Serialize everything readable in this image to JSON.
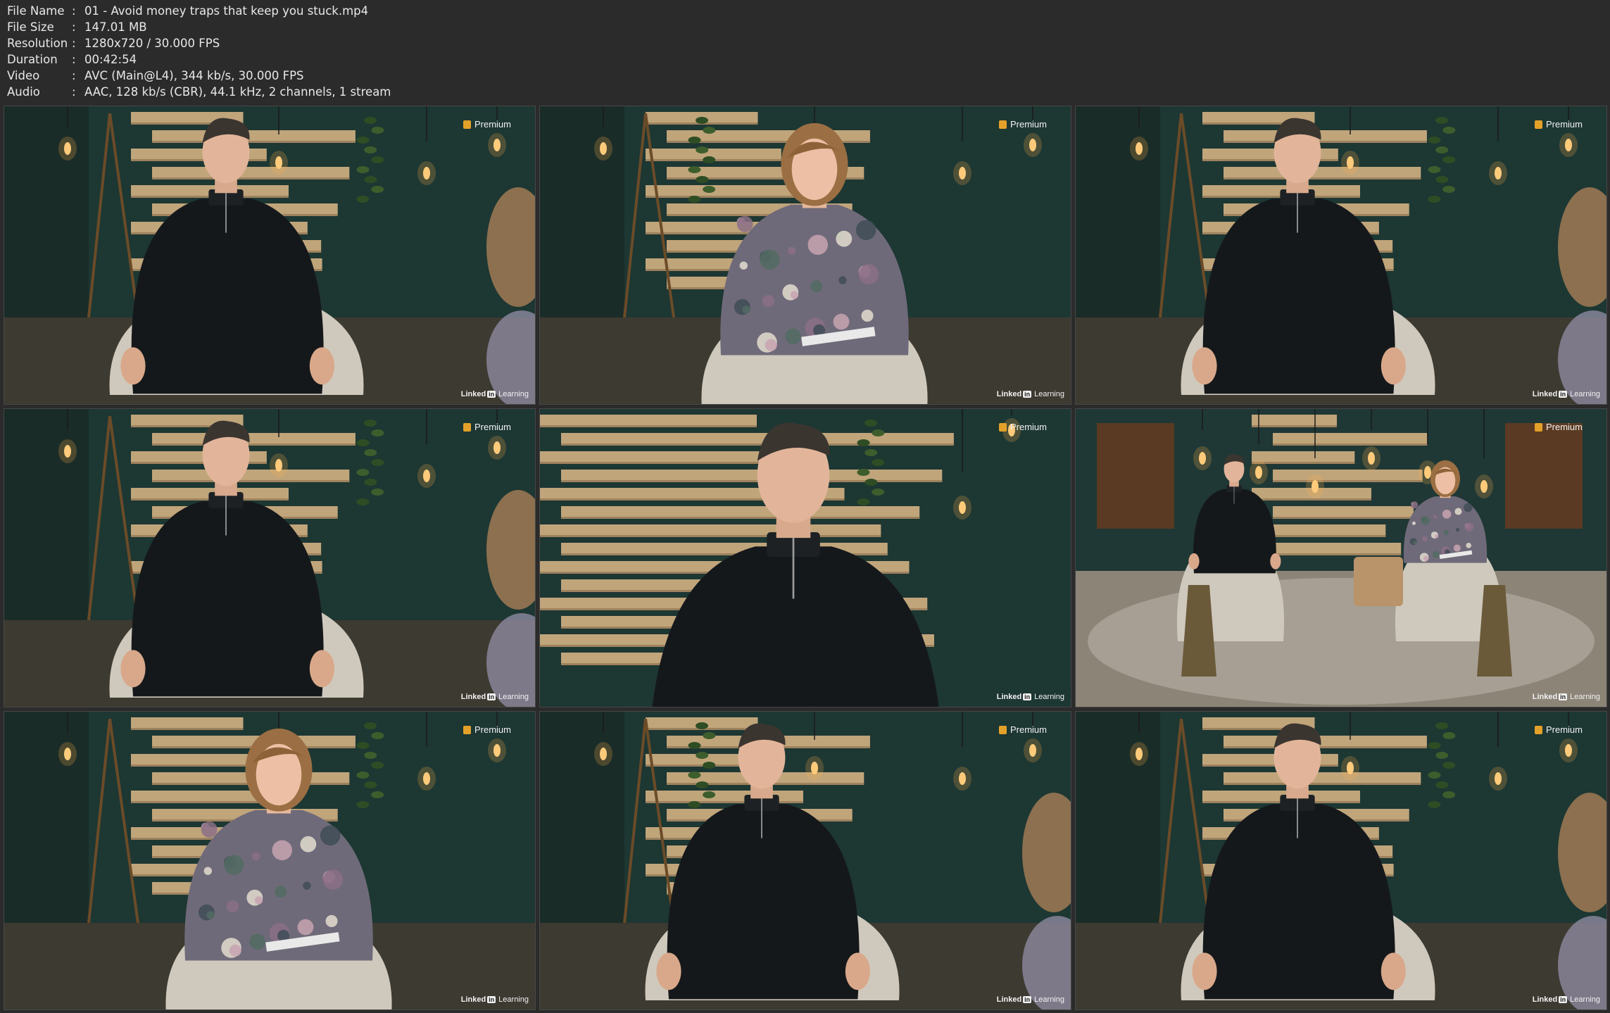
{
  "file_info": [
    {
      "label": "File Name",
      "sep": ":",
      "value": "01 - Avoid money traps that keep you stuck.mp4"
    },
    {
      "label": "File Size",
      "sep": ":",
      "value": "147.01 MB"
    },
    {
      "label": "Resolution",
      "sep": ":",
      "value": "1280x720 / 30.000 FPS"
    },
    {
      "label": "Duration",
      "sep": ":",
      "value": "00:42:54"
    },
    {
      "label": "Video",
      "sep": ":",
      "value": "AVC (Main@L4), 344 kb/s, 30.000 FPS"
    },
    {
      "label": "Audio",
      "sep": ":",
      "value": "AAC, 128 kb/s (CBR), 44.1 kHz, 2 channels, 1 stream"
    }
  ],
  "overlay": {
    "badge_text": "Premium",
    "badge_icon": "premium-icon",
    "brand_word1": "Linked",
    "brand_in": "in",
    "brand_word2": "Learning"
  },
  "colors": {
    "background": "#2b2b2b",
    "wall_green": "#1e3a34",
    "wood_slats": "#c9ab80",
    "premium_accent": "#e3a12a"
  },
  "frames": [
    {
      "subject": "man-medium-shot"
    },
    {
      "subject": "woman-medium-shot"
    },
    {
      "subject": "man-medium-shot"
    },
    {
      "subject": "man-medium-shot"
    },
    {
      "subject": "man-closeup"
    },
    {
      "subject": "wide-two-shot"
    },
    {
      "subject": "woman-medium-shot"
    },
    {
      "subject": "man-medium-shot"
    },
    {
      "subject": "man-medium-shot"
    }
  ]
}
